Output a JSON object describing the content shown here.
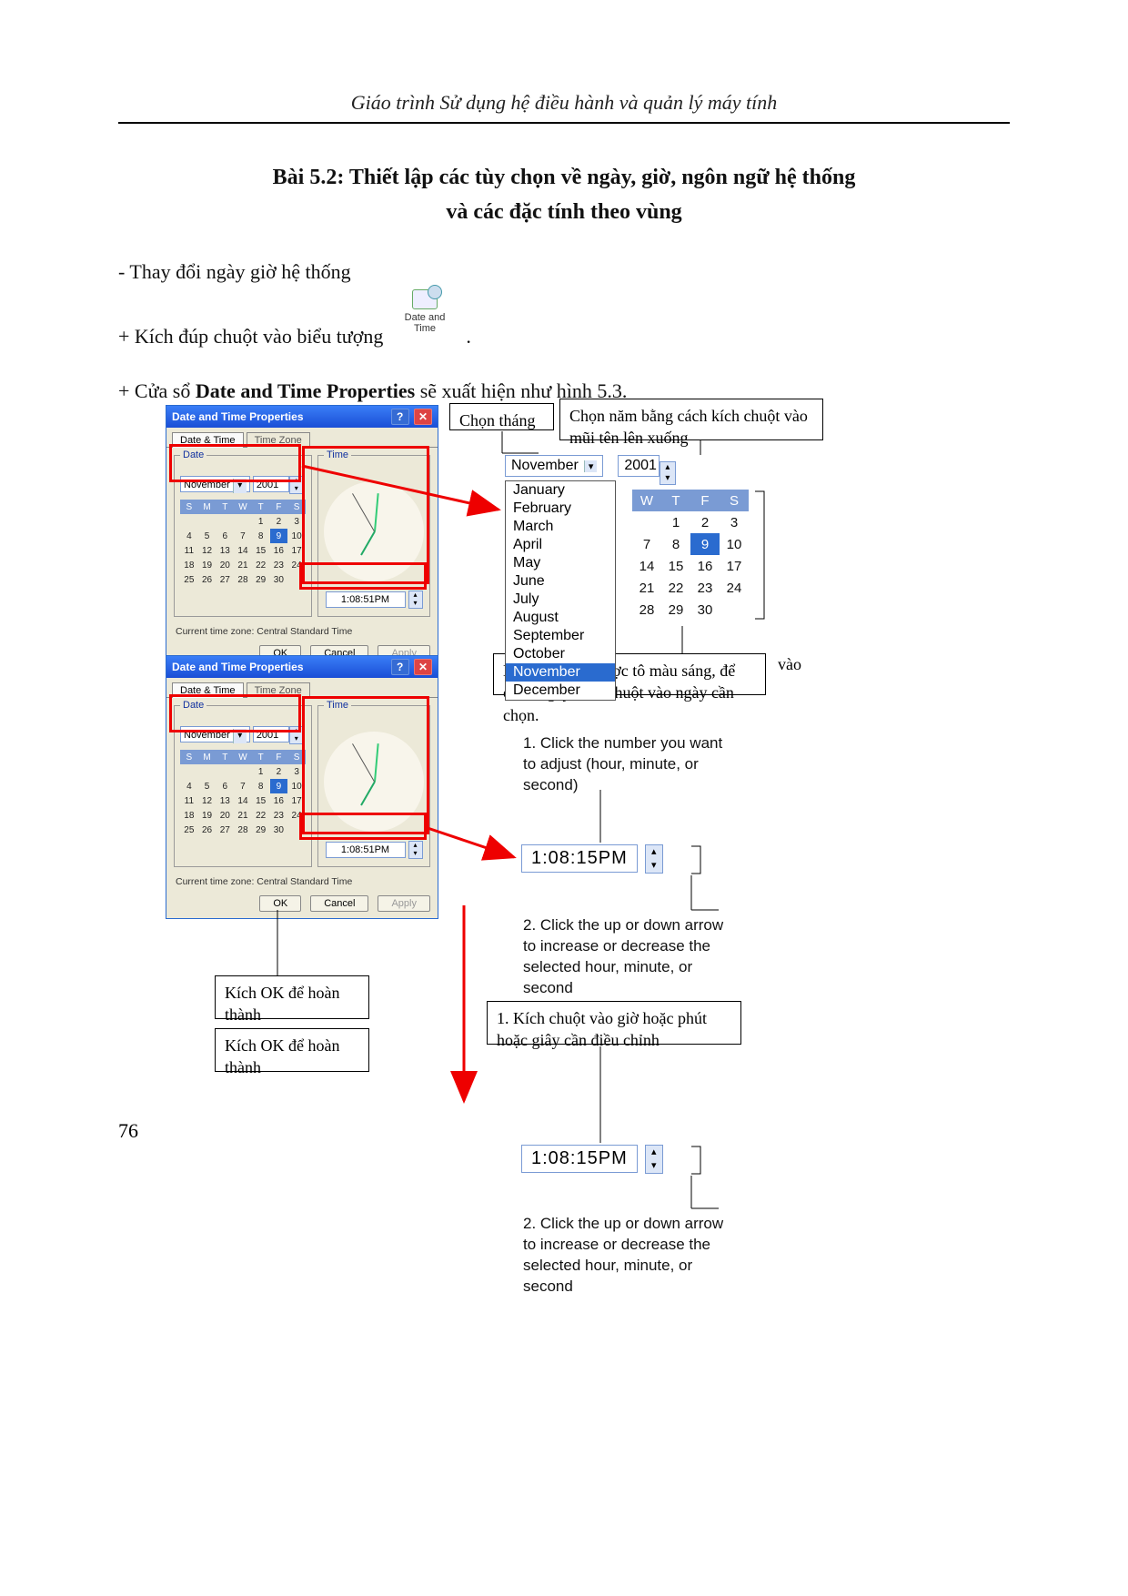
{
  "header": {
    "textbook_title": "Giáo trình Sử dụng hệ điều hành và quản lý máy tính"
  },
  "lesson": {
    "title_line1": "Bài 5.2: Thiết lập các tùy chọn về ngày, giờ, ngôn ngữ hệ thống",
    "title_line2": "và các đặc tính theo vùng",
    "p1": "- Thay đổi ngày giờ hệ thống",
    "p2_a": "+ Kích đúp chuột vào biểu tượng ",
    "p2_b": ".",
    "icon_label": "Date and Time",
    "p3_a": "+ Cửa sổ ",
    "p3_b": "Date and Time Properties",
    "p3_c": " sẽ xuất hiện như hình 5.3."
  },
  "page_number": "76",
  "dialog": {
    "title": "Date and Time Properties",
    "tab_active": "Date & Time",
    "tab_inactive": "Time Zone",
    "group_date": "Date",
    "group_time": "Time",
    "month": "November",
    "year": "2001",
    "weekday_headers": [
      "S",
      "M",
      "T",
      "W",
      "T",
      "F",
      "S"
    ],
    "rows": [
      [
        "",
        "",
        "",
        "",
        "1",
        "2",
        "3"
      ],
      [
        "4",
        "5",
        "6",
        "7",
        "8",
        "9",
        "10"
      ],
      [
        "11",
        "12",
        "13",
        "14",
        "15",
        "16",
        "17"
      ],
      [
        "18",
        "19",
        "20",
        "21",
        "22",
        "23",
        "24"
      ],
      [
        "25",
        "26",
        "27",
        "28",
        "29",
        "30",
        ""
      ]
    ],
    "selected_day": "9",
    "time_value": "1:08:51PM",
    "timezone": "Current time zone:  Central Standard Time",
    "btn_ok": "OK",
    "btn_cancel": "Cancel",
    "btn_apply": "Apply"
  },
  "zoom": {
    "month": "November",
    "year": "2001",
    "months": [
      "January",
      "February",
      "March",
      "April",
      "May",
      "June",
      "July",
      "August",
      "September",
      "October",
      "November",
      "December"
    ],
    "hl_month": "November",
    "cal_headers": [
      "W",
      "T",
      "F",
      "S"
    ],
    "cal_rows": [
      [
        "",
        "1",
        "2",
        "3"
      ],
      [
        "7",
        "8",
        "9",
        "10"
      ],
      [
        "14",
        "15",
        "16",
        "17"
      ],
      [
        "21",
        "22",
        "23",
        "24"
      ],
      [
        "28",
        "29",
        "30",
        ""
      ]
    ],
    "cal_selected": "9",
    "time_value": "1:08:15PM"
  },
  "callouts": {
    "chon_thang": "Chọn tháng",
    "chon_nam": "Chọn năm bằng cách kích chuột vào mũi tên lên xuống",
    "ngay_hien_tai": "Ngày hiện tại được tô màu sáng, để chọn ngày kích chuột vào ngày cần chọn.",
    "click_number_en": "1. Click the number you want to adjust (hour, minute, or second)",
    "click_arrow_en": "2. Click the up or down arrow to increase or decrease the selected hour, minute, or second",
    "kich_ok": "Kích OK để hoàn thành",
    "kich_gio_vn": "1. Kích chuột vào giờ hoặc phút hoặc giây cần điều chỉnh",
    "vao": "vào"
  }
}
